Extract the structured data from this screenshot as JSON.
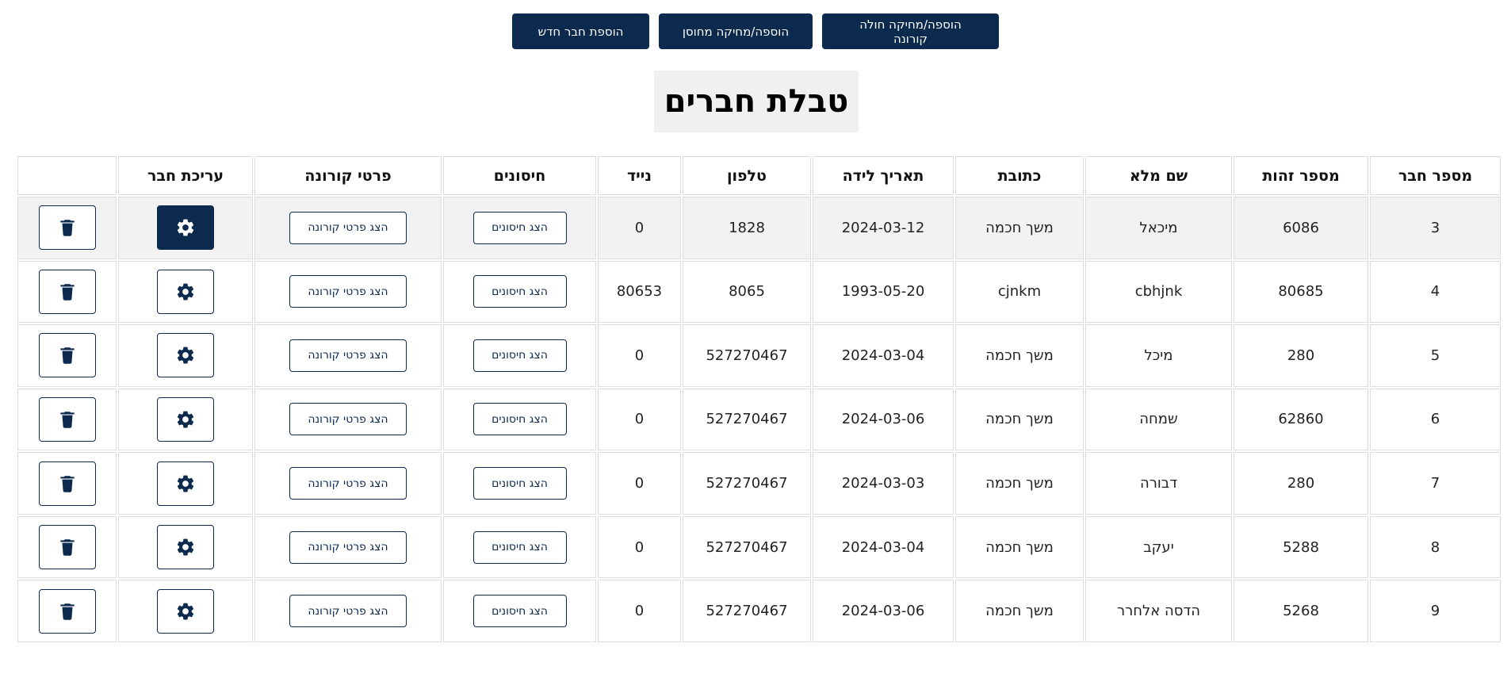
{
  "toolbar": {
    "add_corona_label": "הוספה/מחיקה חולה קורונה",
    "add_vaccine_label": "הוספה/מחיקה מחוסן",
    "add_member_label": "הוספת חבר חדש"
  },
  "page": {
    "title": "טבלת חברים"
  },
  "table": {
    "headers": {
      "member_no": "מספר חבר",
      "id_no": "מספר זהות",
      "full_name": "שם מלא",
      "address": "כתובת",
      "birth_date": "תאריך לידה",
      "phone": "טלפון",
      "mobile": "נייד",
      "vaccines": "חיסונים",
      "corona": "פרטי קורונה",
      "edit": "עריכת חבר",
      "delete": ""
    },
    "show_vaccines_label": "הצג חיסונים",
    "show_corona_label": "הצג פרטי קורונה",
    "rows": [
      {
        "member_no": "3",
        "id_no": "6086",
        "full_name": "מיכאל",
        "address": "משך חכמה",
        "birth_date": "2024-03-12",
        "phone": "1828",
        "mobile": "0"
      },
      {
        "member_no": "4",
        "id_no": "80685",
        "full_name": "cbhjnk",
        "address": "cjnkm",
        "birth_date": "1993-05-20",
        "phone": "8065",
        "mobile": "80653"
      },
      {
        "member_no": "5",
        "id_no": "280",
        "full_name": "מיכל",
        "address": "משך חכמה",
        "birth_date": "2024-03-04",
        "phone": "527270467",
        "mobile": "0"
      },
      {
        "member_no": "6",
        "id_no": "62860",
        "full_name": "שמחה",
        "address": "משך חכמה",
        "birth_date": "2024-03-06",
        "phone": "527270467",
        "mobile": "0"
      },
      {
        "member_no": "7",
        "id_no": "280",
        "full_name": "דבורה",
        "address": "משך חכמה",
        "birth_date": "2024-03-03",
        "phone": "527270467",
        "mobile": "0"
      },
      {
        "member_no": "8",
        "id_no": "5288",
        "full_name": "יעקב",
        "address": "משך חכמה",
        "birth_date": "2024-03-04",
        "phone": "527270467",
        "mobile": "0"
      },
      {
        "member_no": "9",
        "id_no": "5268",
        "full_name": "הדסה אלחרר",
        "address": "משך חכמה",
        "birth_date": "2024-03-06",
        "phone": "527270467",
        "mobile": "0"
      }
    ]
  },
  "icons": {
    "edit": "gear-icon",
    "delete": "trash-icon"
  },
  "colors": {
    "primary": "#0b2a4e",
    "highlight_row": "#f2f2f2",
    "title_bg": "#f0f0f0"
  }
}
